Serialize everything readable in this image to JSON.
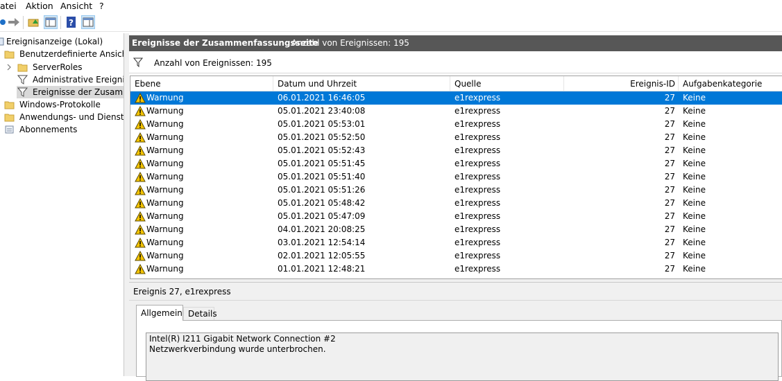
{
  "menu": {
    "items": [
      "atei",
      "Aktion",
      "Ansicht",
      "?"
    ]
  },
  "tree": {
    "items": [
      {
        "label": "Ereignisanzeige (Lokal)",
        "icon": "event-viewer-icon"
      },
      {
        "label": "Benutzerdefinierte Ansichten",
        "icon": "folder-icon"
      },
      {
        "label": "ServerRoles",
        "icon": "folder-icon"
      },
      {
        "label": "Administrative Ereignisse",
        "icon": "filter-icon"
      },
      {
        "label": "Ereignisse der Zusammenfassungsseite",
        "icon": "filter-icon"
      },
      {
        "label": "Windows-Protokolle",
        "icon": "folder-icon"
      },
      {
        "label": "Anwendungs- und Dienstprotokolle",
        "icon": "folder-icon"
      },
      {
        "label": "Abonnements",
        "icon": "subscription-icon"
      }
    ]
  },
  "header": {
    "title": "Ereignisse der Zusammenfassungsseite",
    "count": "Anzahl von Ereignissen: 195"
  },
  "filter": {
    "text": "Anzahl von Ereignissen: 195"
  },
  "table": {
    "columns": [
      "Ebene",
      "Datum und Uhrzeit",
      "Quelle",
      "Ereignis-ID",
      "Aufgabenkategorie"
    ],
    "rows": [
      {
        "level": "Warnung",
        "date": "06.01.2021 16:46:05",
        "source": "e1rexpress",
        "id": "27",
        "category": "Keine"
      },
      {
        "level": "Warnung",
        "date": "05.01.2021 23:40:08",
        "source": "e1rexpress",
        "id": "27",
        "category": "Keine"
      },
      {
        "level": "Warnung",
        "date": "05.01.2021 05:53:01",
        "source": "e1rexpress",
        "id": "27",
        "category": "Keine"
      },
      {
        "level": "Warnung",
        "date": "05.01.2021 05:52:50",
        "source": "e1rexpress",
        "id": "27",
        "category": "Keine"
      },
      {
        "level": "Warnung",
        "date": "05.01.2021 05:52:43",
        "source": "e1rexpress",
        "id": "27",
        "category": "Keine"
      },
      {
        "level": "Warnung",
        "date": "05.01.2021 05:51:45",
        "source": "e1rexpress",
        "id": "27",
        "category": "Keine"
      },
      {
        "level": "Warnung",
        "date": "05.01.2021 05:51:40",
        "source": "e1rexpress",
        "id": "27",
        "category": "Keine"
      },
      {
        "level": "Warnung",
        "date": "05.01.2021 05:51:26",
        "source": "e1rexpress",
        "id": "27",
        "category": "Keine"
      },
      {
        "level": "Warnung",
        "date": "05.01.2021 05:48:42",
        "source": "e1rexpress",
        "id": "27",
        "category": "Keine"
      },
      {
        "level": "Warnung",
        "date": "05.01.2021 05:47:09",
        "source": "e1rexpress",
        "id": "27",
        "category": "Keine"
      },
      {
        "level": "Warnung",
        "date": "04.01.2021 20:08:25",
        "source": "e1rexpress",
        "id": "27",
        "category": "Keine"
      },
      {
        "level": "Warnung",
        "date": "03.01.2021 12:54:14",
        "source": "e1rexpress",
        "id": "27",
        "category": "Keine"
      },
      {
        "level": "Warnung",
        "date": "02.01.2021 12:05:55",
        "source": "e1rexpress",
        "id": "27",
        "category": "Keine"
      },
      {
        "level": "Warnung",
        "date": "01.01.2021 12:48:21",
        "source": "e1rexpress",
        "id": "27",
        "category": "Keine"
      }
    ]
  },
  "detail": {
    "title": "Ereignis 27, e1rexpress",
    "tabs": [
      "Allgemein",
      "Details"
    ],
    "message_line1": "Intel(R) I211 Gigabit Network Connection #2",
    "message_line2": "Netzwerkverbindung wurde unterbrochen."
  },
  "colors": {
    "header_bar": "#575757",
    "selection": "#0078d7",
    "warning": "#f5c400"
  }
}
